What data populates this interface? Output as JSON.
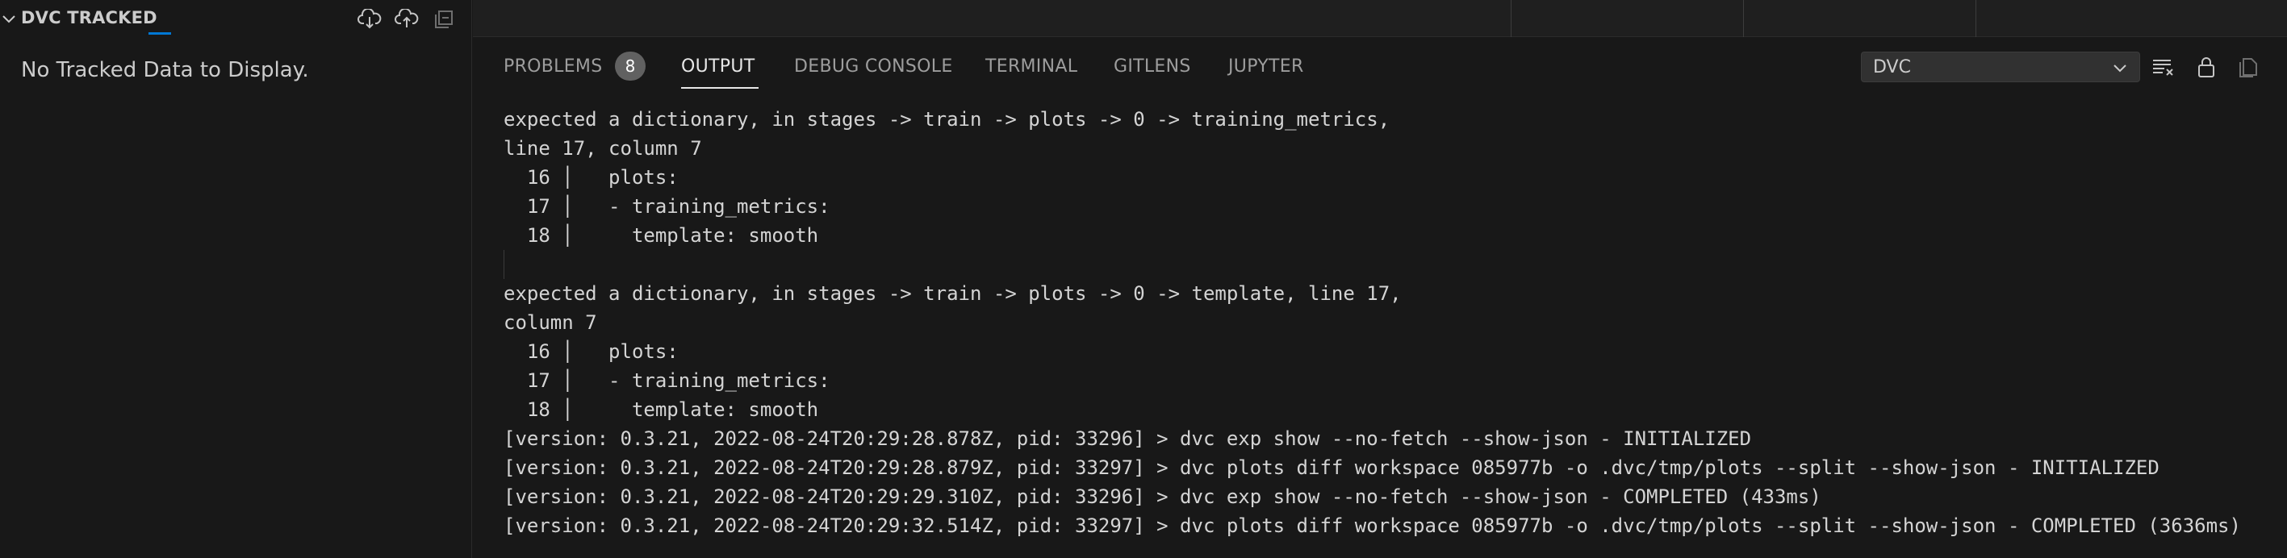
{
  "sidebar": {
    "title": "DVC TRACKED",
    "empty_message": "No Tracked Data to Display.",
    "actions": [
      {
        "icon": "cloud-download-icon"
      },
      {
        "icon": "cloud-upload-icon"
      },
      {
        "icon": "collapse-all-icon"
      }
    ]
  },
  "panel": {
    "tabs": [
      {
        "label": "PROBLEMS",
        "active": false
      },
      {
        "label": "OUTPUT",
        "active": true
      },
      {
        "label": "DEBUG CONSOLE",
        "active": false
      },
      {
        "label": "TERMINAL",
        "active": false
      },
      {
        "label": "GITLENS",
        "active": false
      },
      {
        "label": "JUPYTER",
        "active": false
      }
    ],
    "problems_count": "8",
    "channel_select": "DVC",
    "actions": [
      {
        "icon": "clear-output-icon"
      },
      {
        "icon": "lock-icon"
      },
      {
        "icon": "open-in-editor-icon"
      }
    ]
  },
  "output": {
    "lines": [
      "expected a dictionary, in stages -> train -> plots -> 0 -> training_metrics,",
      "line 17, column 7",
      "  16 │   plots:",
      "  17 │   - training_metrics:",
      "  18 │     template: smooth",
      "",
      "expected a dictionary, in stages -> train -> plots -> 0 -> template, line 17,",
      "column 7",
      "  16 │   plots:",
      "  17 │   - training_metrics:",
      "  18 │     template: smooth",
      "[version: 0.3.21, 2022-08-24T20:29:28.878Z, pid: 33296] > dvc exp show --no-fetch --show-json - INITIALIZED",
      "[version: 0.3.21, 2022-08-24T20:29:28.879Z, pid: 33297] > dvc plots diff workspace 085977b -o .dvc/tmp/plots --split --show-json - INITIALIZED",
      "[version: 0.3.21, 2022-08-24T20:29:29.310Z, pid: 33296] > dvc exp show --no-fetch --show-json - COMPLETED (433ms)",
      "[version: 0.3.21, 2022-08-24T20:29:32.514Z, pid: 33297] > dvc plots diff workspace 085977b -o .dvc/tmp/plots --split --show-json - COMPLETED (3636ms)"
    ]
  }
}
